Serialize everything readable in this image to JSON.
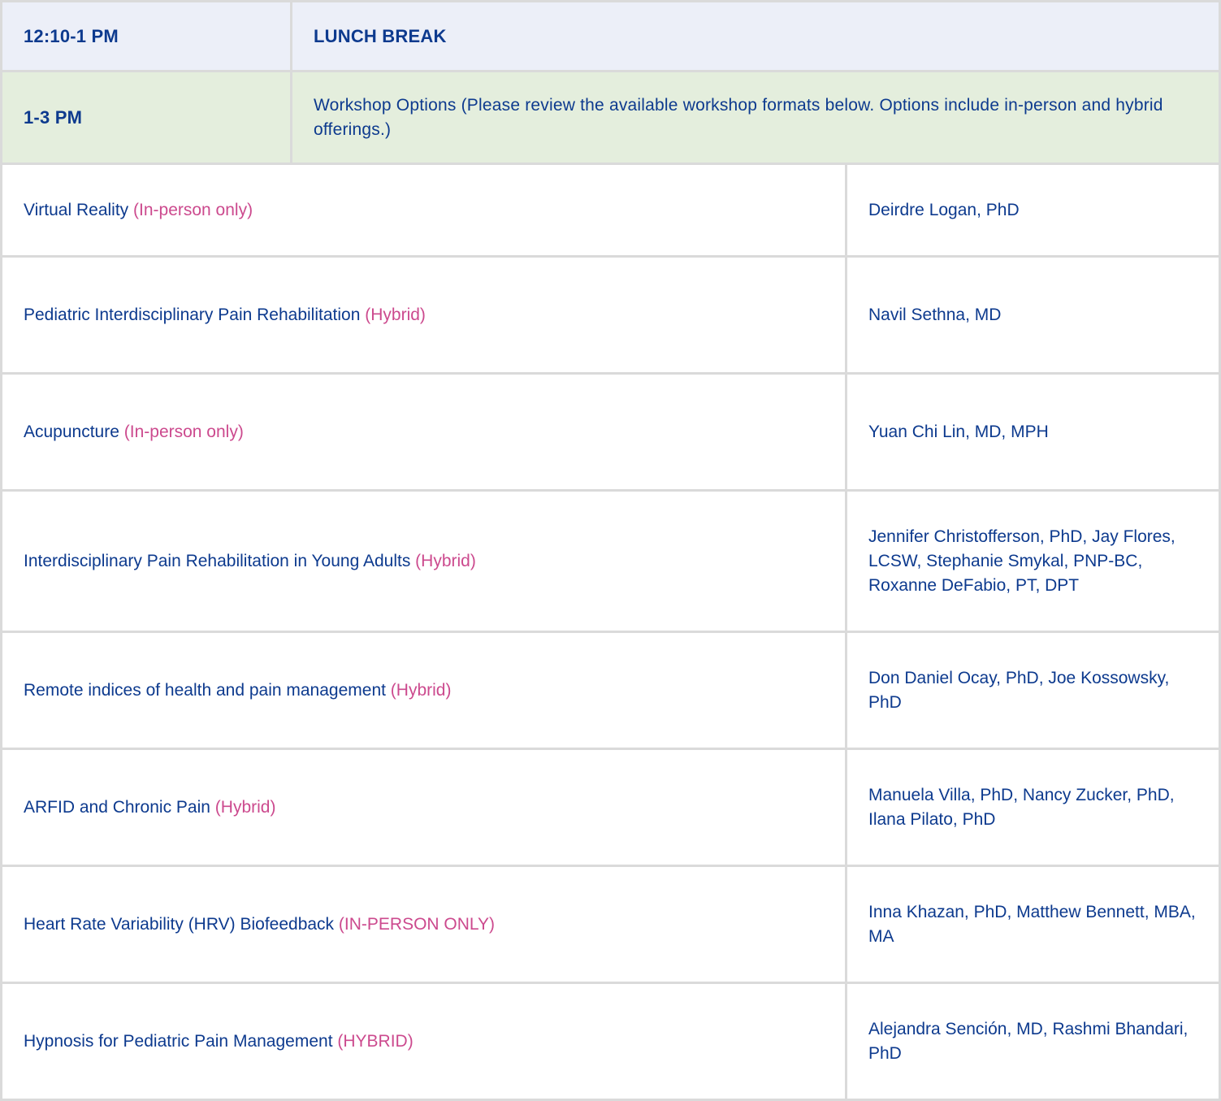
{
  "lunch": {
    "time": "12:10-1 PM",
    "label": "LUNCH BREAK"
  },
  "workshop_block": {
    "time": "1-3 PM",
    "description": "Workshop Options (Please review the available workshop formats below. Options include in-person and hybrid offerings.)"
  },
  "workshops": [
    {
      "title": "Virtual Reality",
      "format": "(In-person only)",
      "presenters": "Deirdre Logan, PhD"
    },
    {
      "title": "Pediatric Interdisciplinary Pain Rehabilitation",
      "format": "(Hybrid)",
      "presenters": "Navil Sethna, MD"
    },
    {
      "title": "Acupuncture",
      "format": "(In-person only)",
      "presenters": "Yuan Chi Lin, MD, MPH"
    },
    {
      "title": "Interdisciplinary Pain Rehabilitation in Young Adults",
      "format": "(Hybrid)",
      "presenters": "Jennifer Christofferson, PhD, Jay Flores, LCSW, Stephanie Smykal, PNP-BC, Roxanne DeFabio, PT, DPT"
    },
    {
      "title": "Remote indices of health and pain management",
      "format": "(Hybrid)",
      "presenters": "Don Daniel Ocay, PhD, Joe Kossowsky, PhD"
    },
    {
      "title": "ARFID and Chronic Pain",
      "format": "(Hybrid)",
      "presenters": "Manuela Villa, PhD, Nancy Zucker, PhD, Ilana Pilato, PhD"
    },
    {
      "title": "Heart Rate Variability (HRV) Biofeedback",
      "format": "(IN-PERSON ONLY)",
      "presenters": "Inna Khazan, PhD, Matthew Bennett, MBA, MA"
    },
    {
      "title": "Hypnosis for Pediatric Pain Management",
      "format": "(HYBRID)",
      "presenters": "Alejandra Sención, MD, Rashmi Bhandari, PhD"
    }
  ],
  "colors": {
    "text": "#0d3a8e",
    "format_tag": "#cc4a8e",
    "lunch_bg": "#eceff8",
    "workshop_bg": "#e4eedd",
    "border": "#dadada"
  }
}
